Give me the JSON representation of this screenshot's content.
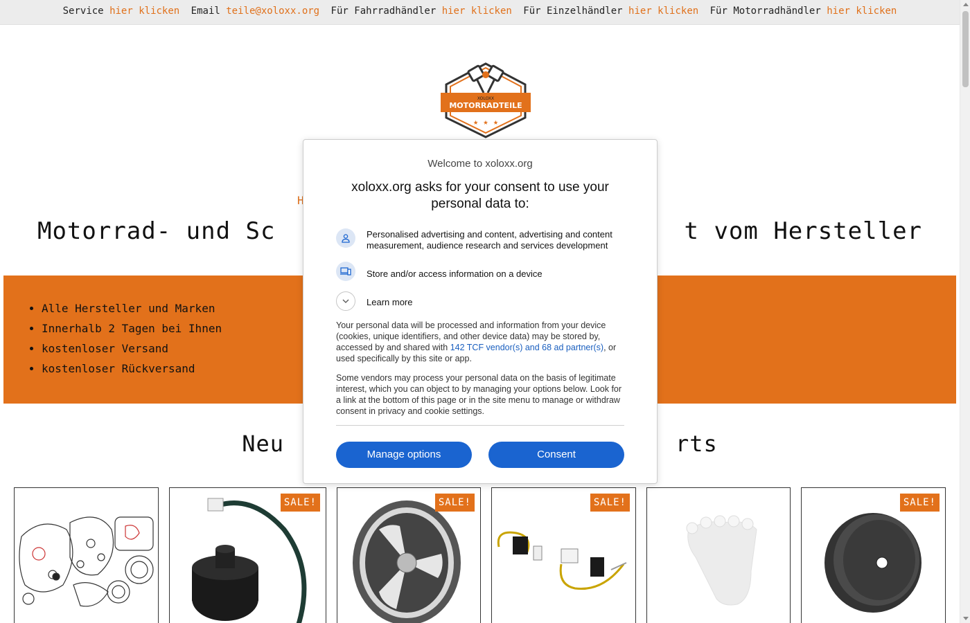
{
  "topbar": {
    "items": [
      {
        "label": "Service",
        "link": "hier klicken"
      },
      {
        "label": "Email",
        "link": "teile@xoloxx.org"
      },
      {
        "label": "Für Fahrradhändler",
        "link": "hier klicken"
      },
      {
        "label": "Für Einzelhändler",
        "link": "hier klicken"
      },
      {
        "label": "Für Motorradhändler",
        "link": "hier klicken"
      }
    ]
  },
  "logo": {
    "brand_small": "XOLOXX",
    "brand_main": "MOTORRADTEILE",
    "colors": {
      "orange": "#e2711b",
      "dark": "#333333"
    }
  },
  "breadcrumb_partial": "H",
  "page_title": {
    "left": "Motorrad- und Sc",
    "right": "t vom Hersteller"
  },
  "benefits": {
    "items": [
      "Alle Hersteller und Marken",
      "Innerhalb 2 Tagen bei Ihnen",
      "kostenloser Versand",
      "kostenloser Rückversand"
    ]
  },
  "section_title": {
    "left": "Neu",
    "right": "rts"
  },
  "products": [
    {
      "name": "gasket-set",
      "sale": ""
    },
    {
      "name": "ignition-switch",
      "sale": "SALE!"
    },
    {
      "name": "chrome-wheel",
      "sale": "SALE!"
    },
    {
      "name": "cable-connector",
      "sale": "SALE!"
    },
    {
      "name": "white-part",
      "sale": ""
    },
    {
      "name": "brake-disc",
      "sale": "SALE!"
    }
  ],
  "consent": {
    "welcome": "Welcome to xoloxx.org",
    "heading": "xoloxx.org asks for your consent to use your personal data to:",
    "purposes": [
      {
        "icon": "person-icon",
        "text": "Personalised advertising and content, advertising and content measurement, audience research and services development"
      },
      {
        "icon": "devices-icon",
        "text": "Store and/or access information on a device"
      },
      {
        "icon": "chevron-down-icon",
        "text": "Learn more"
      }
    ],
    "body1_pre": "Your personal data will be processed and information from your device (cookies, unique identifiers, and other device data) may be stored by, accessed by and shared with ",
    "body1_link": "142 TCF vendor(s) and 68 ad partner(s)",
    "body1_post": ", or used specifically by this site or app.",
    "body2": "Some vendors may process your personal data on the basis of legitimate interest, which you can object to by managing your options below. Look for a link at the bottom of this page or in the site menu to manage or withdraw consent in privacy and cookie settings.",
    "manage_label": "Manage options",
    "consent_label": "Consent",
    "colors": {
      "button": "#1a64d0",
      "link": "#1a5fbf",
      "icon_bg": "#dce6f5"
    }
  }
}
